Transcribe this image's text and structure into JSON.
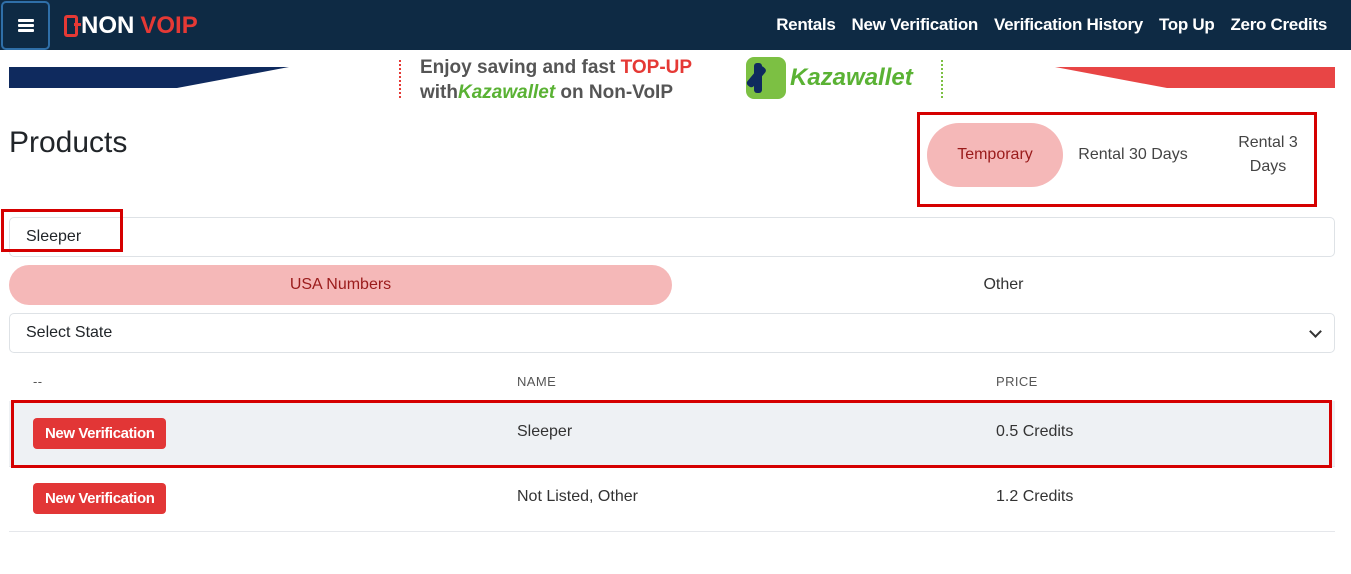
{
  "navbar": {
    "brand_non": "NON",
    "brand_voip": "VOIP",
    "links": [
      "Rentals",
      "New Verification",
      "Verification History",
      "Top Up",
      "Zero Credits"
    ]
  },
  "banner": {
    "line1_prefix": "Enjoy saving and fast ",
    "line1_highlight": "TOP-UP",
    "line2_prefix": "with",
    "line2_brand": "Kazawallet",
    "line2_suffix": " on Non-VoIP",
    "logo_text": "Kazawallet"
  },
  "page": {
    "title": "Products"
  },
  "type_tabs": [
    {
      "label": "Temporary",
      "active": true
    },
    {
      "label": "Rental 30 Days",
      "active": false
    },
    {
      "label": "Rental 3 Days",
      "active": false
    }
  ],
  "search": {
    "value": "Sleeper"
  },
  "number_tabs": [
    {
      "label": "USA Numbers",
      "active": true
    },
    {
      "label": "Other",
      "active": false
    }
  ],
  "state_select": {
    "selected": "Select State"
  },
  "table": {
    "headers": [
      "--",
      "NAME",
      "PRICE"
    ],
    "rows": [
      {
        "action": "New Verification",
        "name": "Sleeper",
        "price": "0.5 Credits"
      },
      {
        "action": "New Verification",
        "name": "Not Listed, Other",
        "price": "1.2 Credits"
      }
    ]
  },
  "colors": {
    "navbar": "#0e2a44",
    "accent_red": "#e23636",
    "active_tab_bg": "#f5b8b8",
    "highlight_border": "#d50000"
  }
}
